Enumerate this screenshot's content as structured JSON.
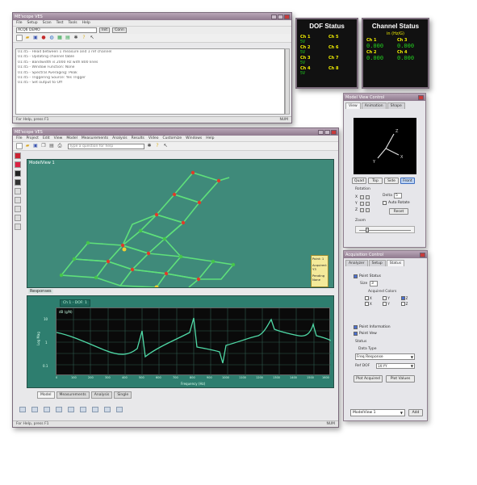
{
  "log_window": {
    "title": "ME'scope VES",
    "menu": [
      "File",
      "Setup",
      "Scan",
      "Test",
      "Tools",
      "Help"
    ],
    "combo_value": "ACQ6 DEMO",
    "toolbar_btns": [
      "Init",
      "Conn"
    ],
    "log_lines": [
      "01:45 - Head between 1 measure and 1 ref channel",
      "01:45 - Updating channel table",
      "01:45 - Bandwidth is 2000 Hz with 800 lines",
      "01:45 - Window Function: None",
      "01:45 - Spectral Averaging: Peak",
      "01:45 - Triggering Source: Yes Trigger",
      "01:45 - Set output to Off"
    ],
    "status_left": "For Help, press F1",
    "status_right": "NUM"
  },
  "dof_status": {
    "title": "DOF Status",
    "channels": [
      {
        "label": "Ch 1",
        "value": "5V"
      },
      {
        "label": "Ch 5",
        "value": ""
      },
      {
        "label": "Ch 2",
        "value": "5V"
      },
      {
        "label": "Ch 6",
        "value": ""
      },
      {
        "label": "Ch 3",
        "value": "5V"
      },
      {
        "label": "Ch 7",
        "value": ""
      },
      {
        "label": "Ch 4",
        "value": "5V"
      },
      {
        "label": "Ch 8",
        "value": ""
      }
    ]
  },
  "channel_status": {
    "title": "Channel Status",
    "subtitle": "in (Hz/G)",
    "channels": [
      {
        "label": "Ch 1",
        "value": "0.000"
      },
      {
        "label": "Ch 3",
        "value": "0.000"
      },
      {
        "label": "Ch 2",
        "value": "0.000"
      },
      {
        "label": "Ch 4",
        "value": "0.000"
      }
    ]
  },
  "main_window": {
    "title": "ME'scope VES",
    "menu": [
      "File",
      "Project",
      "Edit",
      "View",
      "Model",
      "Measurements",
      "Analysis",
      "Results",
      "Video",
      "Customize",
      "Windows",
      "Help"
    ],
    "help_placeholder": "Type a question for help",
    "model_title": "ModelView 1",
    "pane_label": "Responses",
    "point_info": [
      "Point: 1",
      "Acquired:",
      "Y3",
      "Pending",
      "None"
    ],
    "tabs": [
      "Model",
      "Measurements",
      "Analysis",
      "Single"
    ],
    "status_left": "For Help, press F1",
    "status_right": "NUM"
  },
  "fft_plot": {
    "trace_label": "Ch 1 - DOF: 1",
    "trace_sub": "dB (g/N)",
    "ylabel": "Log Mag",
    "xlabel": "Frequency (Hz)",
    "x_ticks": [
      "0",
      "100",
      "200",
      "300",
      "400",
      "500",
      "600",
      "700",
      "800",
      "900",
      "1000",
      "1100",
      "1200",
      "1300",
      "1400",
      "1500",
      "1600"
    ],
    "y_ticks": [
      "10",
      "1",
      "0.1"
    ]
  },
  "model_view_control": {
    "title": "Model View Control",
    "tabs": [
      "View",
      "Animation",
      "Shape"
    ],
    "view_btns": [
      "Quad",
      "Top",
      "Side",
      "Front"
    ],
    "rotation_label": "Rotation",
    "axes": [
      "X",
      "Y",
      "Z"
    ],
    "delta_label": "Delta",
    "delta_value": "5",
    "auto_rotate_label": "Auto Rotate",
    "reset_label": "Reset",
    "zoom_label": "Zoom"
  },
  "acquisition_control": {
    "title": "Acquisition Control",
    "tabs": [
      "Analyzer",
      "Setup",
      "Status"
    ],
    "point_status_label": "Point Status",
    "size_label": "Size",
    "size_value": "3",
    "acquired_colors_label": "Acquired Colors",
    "color_boxes": [
      "X",
      "Y",
      "Z",
      "X",
      "Y",
      "Z"
    ],
    "point_information_label": "Point Information",
    "point_vew_label": "Point Vew",
    "status_label": "Status",
    "data_type_label": "Data Type",
    "data_type_value": "Freq Response",
    "ref_dof_label": "Ref DOF",
    "ref_dof_value": "1X:YY",
    "plot_acquired_label": "Plot Acquired",
    "plot_values_label": "Plot Values",
    "footer_select": "ModelView 1",
    "footer_btn": "Add"
  },
  "colors": {
    "model_bg": "#3f8a7a",
    "plot_bg": "#0a0a0a",
    "trace": "#4fd9a6",
    "frame_bg": "#2e7e6f",
    "node_red": "#e23a2a",
    "node_green": "#46c64a",
    "yellow_text": "#f3f000",
    "green_text": "#22d11f"
  }
}
